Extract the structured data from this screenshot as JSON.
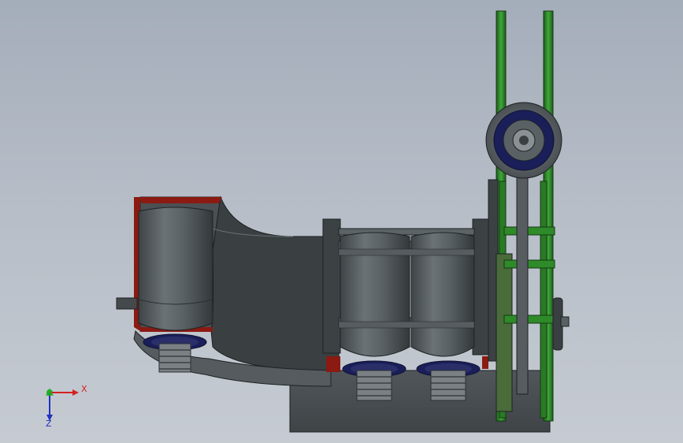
{
  "viewport": {
    "background_top": "#a4adba",
    "background_bottom": "#c6cbd2"
  },
  "model": {
    "body_color": "#4d5356",
    "section_color": "#8a1a12",
    "frame_color": "#2f8a2a",
    "seal_color": "#1a1f5a"
  },
  "triad": {
    "x_label": "X",
    "z_label": "Z",
    "x_color": "#d42020",
    "y_color": "#20b020",
    "z_color": "#2030c0"
  }
}
